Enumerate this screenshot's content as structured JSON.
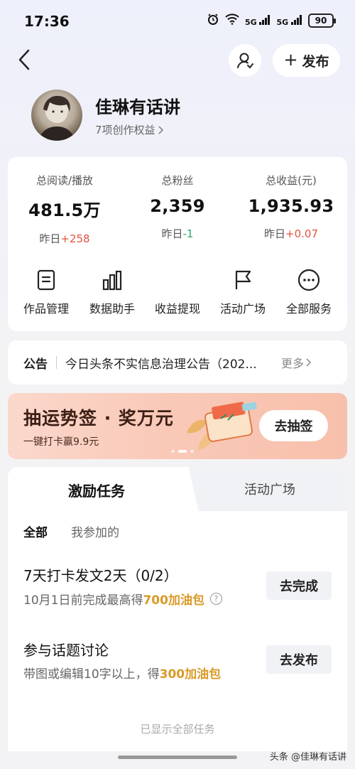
{
  "status": {
    "time": "17:36",
    "signal1": "5G",
    "signal2": "5G",
    "battery": "90"
  },
  "header": {
    "publish_label": "发布"
  },
  "profile": {
    "name": "佳琳有话讲",
    "rights": "7项创作权益"
  },
  "stats": [
    {
      "label": "总阅读/播放",
      "value": "481.5万",
      "delta_prefix": "昨日",
      "delta": "+258",
      "trend": "up"
    },
    {
      "label": "总粉丝",
      "value": "2,359",
      "delta_prefix": "昨日",
      "delta": "-1",
      "trend": "down"
    },
    {
      "label": "总收益(元)",
      "value": "1,935.93",
      "delta_prefix": "昨日",
      "delta": "+0.07",
      "trend": "up"
    }
  ],
  "tools": [
    {
      "label": "作品管理",
      "icon": "document-icon"
    },
    {
      "label": "数据助手",
      "icon": "bar-chart-icon"
    },
    {
      "label": "收益提现",
      "icon": ""
    },
    {
      "label": "活动广场",
      "icon": "flag-icon"
    },
    {
      "label": "全部服务",
      "icon": "more-icon"
    }
  ],
  "notice": {
    "label": "公告",
    "text": "今日头条不实信息治理公告（202...",
    "more": "更多"
  },
  "banner": {
    "title": "抽运势签 · 奖万元",
    "subtitle": "一键打卡赢9.9元",
    "button": "去抽签",
    "slide_index": 2,
    "slide_count": 3
  },
  "tasks": {
    "tab_active": "激励任务",
    "tab_inactive": "活动广场",
    "filter_all": "全部",
    "filter_mine": "我参加的",
    "items": [
      {
        "title": "7天打卡发文2天（0/2）",
        "desc_prefix": "10月1日前完成最高得",
        "desc_highlight": "700加油包",
        "button": "去完成"
      },
      {
        "title": "参与话题讨论",
        "desc_prefix": "带图或编辑10字以上，得",
        "desc_highlight": "300加油包",
        "button": "去发布"
      }
    ],
    "footer": "已显示全部任务"
  },
  "watermark": "头条 @佳琳有话讲"
}
